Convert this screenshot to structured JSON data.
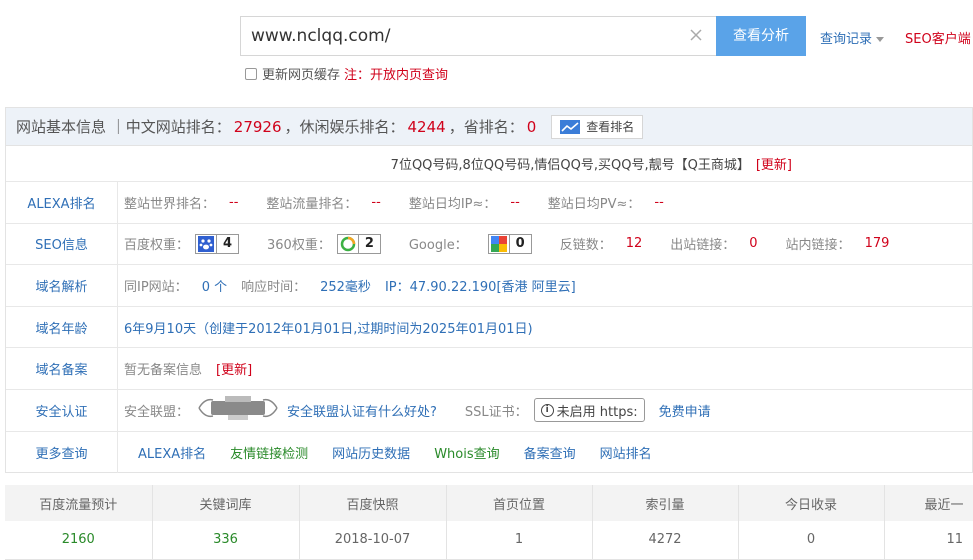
{
  "search": {
    "value": "www.nclqq.com/",
    "button_label": "查看分析",
    "history_label": "查询记录",
    "client_label": "SEO客户端",
    "cache_label": "更新网页缓存",
    "cache_note": "注：开放内页查询"
  },
  "header": {
    "title": "网站基本信息 ｜中文网站排名：",
    "cn_rank": "27926",
    "cat_label": "，休闲娱乐排名：",
    "cat_rank": "4244",
    "prov_label": "，省排名：",
    "prov_rank": "0",
    "rank_button": "查看排名"
  },
  "promo": {
    "text": "7位QQ号码,8位QQ号码,情侣QQ号,买QQ号,靓号【Q王商城】",
    "update": "[更新]"
  },
  "rows": {
    "alexa": {
      "label": "ALEXA排名",
      "world_k": "整站世界排名：",
      "world_v": "--",
      "traffic_k": "整站流量排名：",
      "traffic_v": "--",
      "ip_k": "整站日均IP≈：",
      "ip_v": "--",
      "pv_k": "整站日均PV≈：",
      "pv_v": "--"
    },
    "seo": {
      "label": "SEO信息",
      "baidu_k": "百度权重：",
      "baidu_v": "4",
      "s360_k": "360权重：",
      "s360_v": "2",
      "google_k": "Google：",
      "google_v": "0",
      "backlinks_k": "反链数：",
      "backlinks_v": "12",
      "outlinks_k": "出站链接：",
      "outlinks_v": "0",
      "inlinks_k": "站内链接：",
      "inlinks_v": "179"
    },
    "dns": {
      "label": "域名解析",
      "sameip_k": "同IP网站：",
      "sameip_v": "0 个",
      "resp_k": "响应时间：",
      "resp_v": "252毫秒",
      "ip_text": "IP：47.90.22.190[香港 阿里云]"
    },
    "age": {
      "label": "域名年龄",
      "text": "6年9月10天（创建于2012年01月01日,过期时间为2025年01月01日)"
    },
    "icp": {
      "label": "域名备案",
      "text": "暂无备案信息",
      "update": "[更新]"
    },
    "security": {
      "label": "安全认证",
      "alliance_k": "安全联盟：",
      "alliance_link": "安全联盟认证有什么好处?",
      "ssl_k": "SSL证书：",
      "ssl_btn": "未启用 https:",
      "ssl_link": "免费申请"
    },
    "more": {
      "label": "更多查询",
      "links": [
        "ALEXA排名",
        "友情链接检测",
        "网站历史数据",
        "Whois查询",
        "备案查询",
        "网站排名"
      ]
    }
  },
  "stats": {
    "headers": [
      "百度流量预计",
      "关键词库",
      "百度快照",
      "首页位置",
      "索引量",
      "今日收录",
      "最近一"
    ],
    "values": [
      "2160",
      "336",
      "2018-10-07",
      "1",
      "4272",
      "0",
      "11"
    ]
  },
  "colors": {
    "accent": "#5aa3e8",
    "link": "#2f6fb6",
    "red": "#d0021b",
    "green": "#2a8a2a"
  }
}
